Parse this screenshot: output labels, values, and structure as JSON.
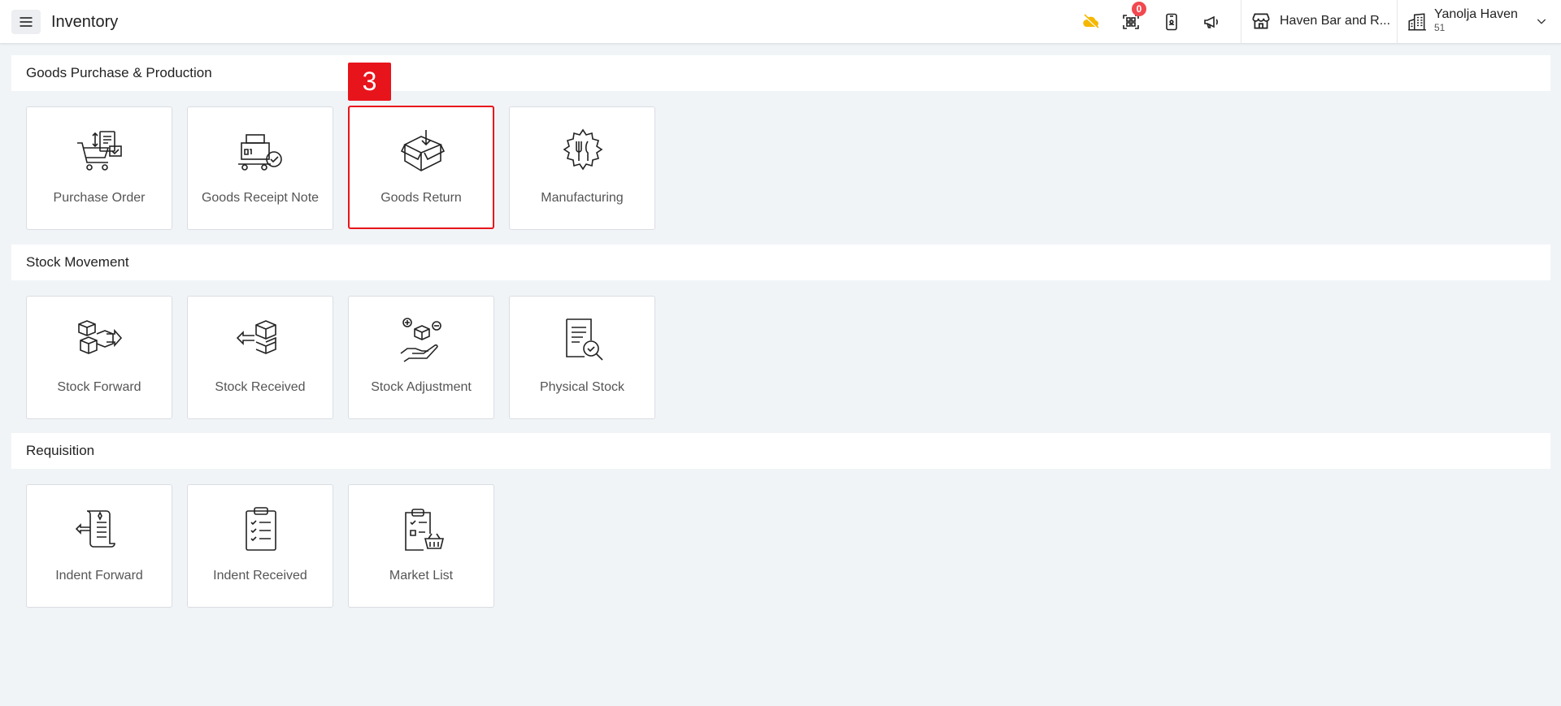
{
  "header": {
    "title": "Inventory",
    "notification_count": "0",
    "outlet": "Haven Bar and R...",
    "hotel_name": "Yanolja Haven",
    "hotel_code": "51"
  },
  "sections": [
    {
      "title": "Goods Purchase & Production",
      "items": [
        "Purchase Order",
        "Goods Receipt Note",
        "Goods Return",
        "Manufacturing"
      ]
    },
    {
      "title": "Stock Movement",
      "items": [
        "Stock Forward",
        "Stock Received",
        "Stock Adjustment",
        "Physical Stock"
      ]
    },
    {
      "title": "Requisition",
      "items": [
        "Indent Forward",
        "Indent Received",
        "Market List"
      ]
    }
  ],
  "annotation_marker": "3",
  "colors": {
    "highlight": "#e8141b",
    "badge": "#f0494f",
    "cloud_icon": "#f5b800"
  }
}
